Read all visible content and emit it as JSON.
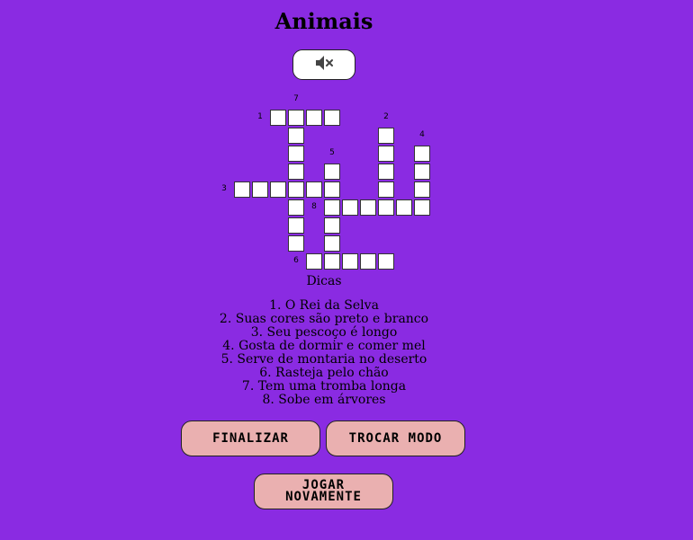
{
  "title": "Animais",
  "sound_button": {
    "icon": "speaker-muted-icon"
  },
  "clues_title": "Dicas",
  "clues": [
    "1. O Rei da Selva",
    "2. Suas cores são preto e branco",
    "3. Seu pescoço é longo",
    "4. Gosta de dormir e comer mel",
    "5. Serve de montaria no deserto",
    "6. Rasteja pelo chão",
    "7. Tem uma tromba longa",
    "8. Sobe em árvores"
  ],
  "buttons": {
    "finish": "FINALIZAR",
    "switch_mode": "TROCAR MODO",
    "play_again_line1": "JOGAR",
    "play_again_line2": "NOVAMENTE"
  },
  "crossword": {
    "rows": 10,
    "cols": 12,
    "words": [
      {
        "number": "1",
        "direction": "across",
        "row": 1,
        "col": 2,
        "length": 4
      },
      {
        "number": "2",
        "direction": "down",
        "row": 2,
        "col": 8,
        "length": 5
      },
      {
        "number": "3",
        "direction": "across",
        "row": 5,
        "col": 0,
        "length": 6
      },
      {
        "number": "4",
        "direction": "down",
        "row": 3,
        "col": 10,
        "length": 4
      },
      {
        "number": "5",
        "direction": "down",
        "row": 4,
        "col": 5,
        "length": 5
      },
      {
        "number": "6",
        "direction": "across",
        "row": 9,
        "col": 4,
        "length": 5
      },
      {
        "number": "7",
        "direction": "down",
        "row": 1,
        "col": 3,
        "length": 8
      },
      {
        "number": "8",
        "direction": "across",
        "row": 6,
        "col": 5,
        "length": 6
      }
    ]
  }
}
